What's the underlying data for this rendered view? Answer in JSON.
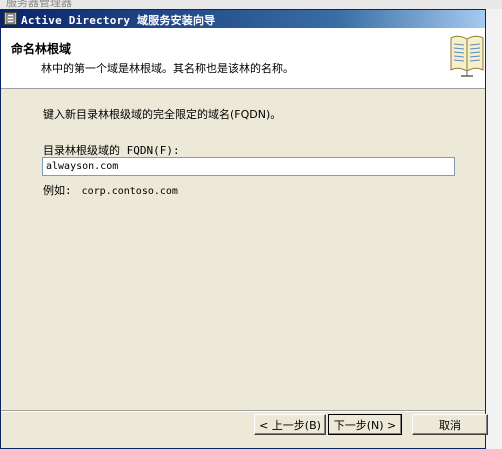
{
  "window": {
    "title": "Active Directory 域服务安装向导",
    "background_title": "服务器管理器"
  },
  "header": {
    "title": "命名林根域",
    "subtitle": "林中的第一个域是林根域。其名称也是该林的名称。"
  },
  "form": {
    "prompt": "键入新目录林根级域的完全限定的域名(FQDN)。",
    "fqdn_label": "目录林根级域的 FQDN(F):",
    "fqdn_value": "alwayson.com",
    "example_label": "例如:",
    "example_value": "corp.contoso.com"
  },
  "buttons": {
    "back": "< 上一步(B)",
    "next": "下一步(N) >",
    "cancel": "取消"
  },
  "icons": {
    "title": "server-icon",
    "header": "book-icon"
  },
  "colors": {
    "titlebar": "#0a246a",
    "dialog_bg": "#ece9d8",
    "header_bg": "#ffffff"
  }
}
